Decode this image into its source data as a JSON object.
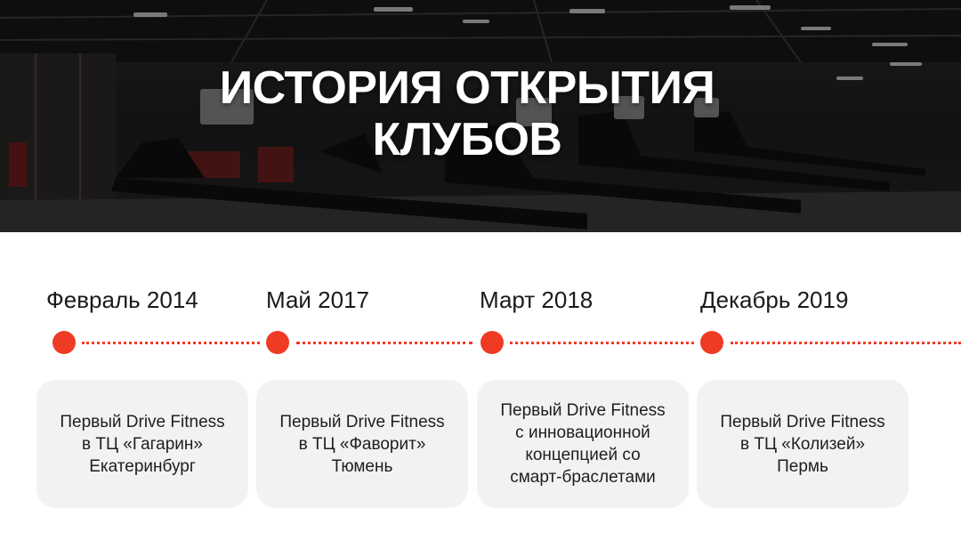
{
  "hero": {
    "title_line1": "ИСТОРИЯ ОТКРЫТИЯ",
    "title_line2": "КЛУБОВ"
  },
  "accent_color": "#ef3b24",
  "timeline": [
    {
      "date": "Февраль 2014",
      "lines": [
        "Первый Drive Fitness",
        "в ТЦ «Гагарин»",
        "Екатеринбург"
      ]
    },
    {
      "date": "Май 2017",
      "lines": [
        "Первый Drive Fitness",
        "в ТЦ «Фаворит»",
        "Тюмень"
      ]
    },
    {
      "date": "Март 2018",
      "lines": [
        "Первый Drive Fitness",
        "с инновационной",
        "концепцией со",
        "смарт-браслетами"
      ]
    },
    {
      "date": "Декабрь 2019",
      "lines": [
        "Первый Drive Fitness",
        "в ТЦ «Колизей»",
        "Пермь"
      ]
    }
  ]
}
